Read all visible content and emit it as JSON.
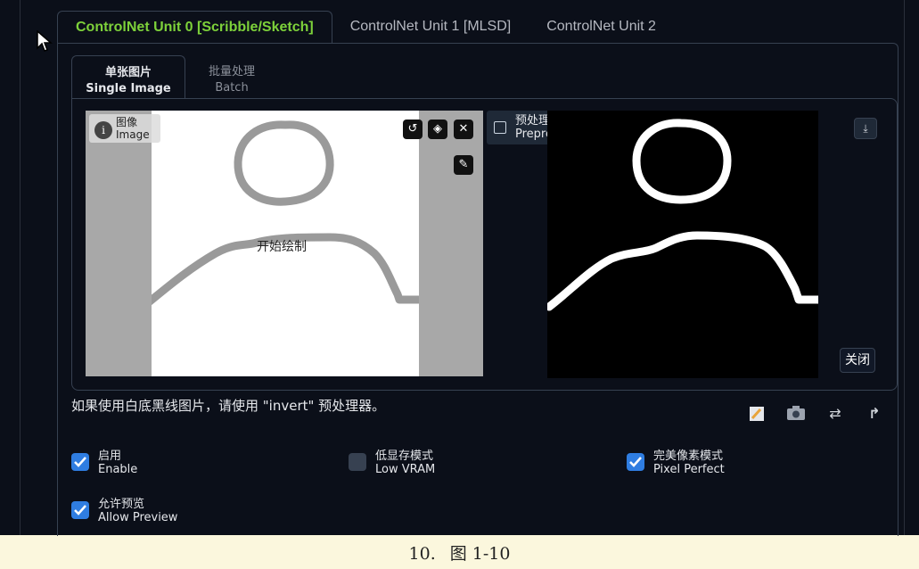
{
  "unit_tabs": [
    {
      "label": "ControlNet Unit 0 [Scribble/Sketch]",
      "active": true
    },
    {
      "label": "ControlNet Unit 1 [MLSD]",
      "active": false
    },
    {
      "label": "ControlNet Unit 2",
      "active": false
    }
  ],
  "mode_tabs": [
    {
      "label_cn": "单张图片",
      "label_en": "Single Image",
      "active": true
    },
    {
      "label_cn": "批量处理",
      "label_en": "Batch",
      "active": false
    }
  ],
  "image_input": {
    "label_cn": "图像",
    "label_en": "Image",
    "overlay_text": "开始绘制",
    "buttons": [
      "undo-icon",
      "eraser-icon",
      "close-icon",
      "brush-icon"
    ]
  },
  "preview": {
    "label_cn": "预处理结果预览",
    "label_en": "Preprocessor Preview",
    "close_label": "关闭",
    "download_icon": "download-icon"
  },
  "hint": "如果使用白底黑线图片，请使用 \"invert\" 预处理器。",
  "tool_icons": [
    "edit-icon",
    "camera-icon",
    "swap-icon",
    "upload-arrow-icon"
  ],
  "checkboxes": [
    {
      "label_cn": "启用",
      "label_en": "Enable",
      "checked": true
    },
    {
      "label_cn": "低显存模式",
      "label_en": "Low VRAM",
      "checked": false
    },
    {
      "label_cn": "完美像素模式",
      "label_en": "Pixel Perfect",
      "checked": true
    },
    {
      "label_cn": "允许预览",
      "label_en": "Allow Preview",
      "checked": true
    }
  ],
  "caption": {
    "number": "10.",
    "text": "图 1-10"
  },
  "colors": {
    "accent": "#7dd13a",
    "checkbox": "#2f7de1",
    "background": "#0b0f19"
  }
}
